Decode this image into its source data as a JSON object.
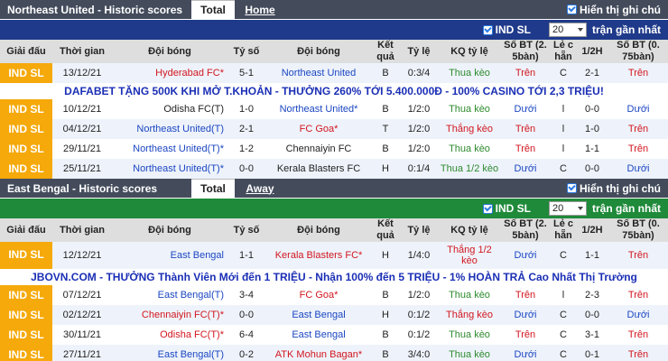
{
  "section1": {
    "title": "Northeast United - Historic scores",
    "tab_total": "Total",
    "tab_other": "Home",
    "show_notes": "Hiển thị ghi chú",
    "league_filter": "IND SL",
    "count": "20",
    "recent_label": "trận gần nhất",
    "banner": "DAFABET TẶNG 500K KHI MỞ T.KHOẢN - THƯỞNG 260% TỚI 5.400.000Đ - 100% CASINO TỚI 2,3 TRIỆU!"
  },
  "section2": {
    "title": "East Bengal - Historic scores",
    "tab_total": "Total",
    "tab_other": "Away",
    "show_notes": "Hiển thị ghi chú",
    "league_filter": "IND SL",
    "count": "20",
    "recent_label": "trận gần nhất",
    "banner": "JBOVN.COM - THƯỞNG Thành Viên Mới đến 1 TRIỆU - Nhận 100% đến 5 TRIỆU - 1% HOÀN TRẢ Cao Nhất Thị Trường"
  },
  "headers": {
    "league": "Giải đấu",
    "time": "Thời gian",
    "home": "Đội bóng",
    "score": "Tỷ số",
    "away": "Đội bóng",
    "result": "Kết quả",
    "odds": "Tỷ lệ",
    "odds_result": "KQ tỷ lệ",
    "goals25": "Số BT (2. 5bàn)",
    "oddeven": "Lẻ c hẵn",
    "half": "1/2H",
    "goals075": "Số BT (0. 75bàn)"
  },
  "colors": {
    "league_bg": "#f5a90a",
    "team_blue": "#1b46c2",
    "team_red": "#d2161f",
    "win_green": "#2e8b2e",
    "filterbar_blue": "#1f3a8a",
    "filterbar_green": "#1f8a3a"
  },
  "rows1": [
    {
      "league": "IND SL",
      "date": "13/12/21",
      "home": "Hyderabad FC*",
      "score": "5-1",
      "away": "Northeast United",
      "res": "B",
      "odds": "0:3/4",
      "oddsres": "Thua kèo",
      "g25": "Trên",
      "oe": "C",
      "half": "2-1",
      "g075": "Trên"
    },
    {
      "league": "IND SL",
      "date": "10/12/21",
      "home": "Odisha FC(T)",
      "score": "1-0",
      "away": "Northeast United*",
      "res": "B",
      "odds": "1/2:0",
      "oddsres": "Thua kèo",
      "g25": "Dưới",
      "oe": "l",
      "half": "0-0",
      "g075": "Dưới"
    },
    {
      "league": "IND SL",
      "date": "04/12/21",
      "home": "Northeast United(T)",
      "score": "2-1",
      "away": "FC Goa*",
      "res": "T",
      "odds": "1/2:0",
      "oddsres": "Thắng kèo",
      "g25": "Trên",
      "oe": "l",
      "half": "1-0",
      "g075": "Trên"
    },
    {
      "league": "IND SL",
      "date": "29/11/21",
      "home": "Northeast United(T)*",
      "score": "1-2",
      "away": "Chennaiyin FC",
      "res": "B",
      "odds": "1/2:0",
      "oddsres": "Thua kèo",
      "g25": "Trên",
      "oe": "l",
      "half": "1-1",
      "g075": "Trên"
    },
    {
      "league": "IND SL",
      "date": "25/11/21",
      "home": "Northeast United(T)*",
      "score": "0-0",
      "away": "Kerala Blasters FC",
      "res": "H",
      "odds": "0:1/4",
      "oddsres": "Thua 1/2 kèo",
      "g25": "Dưới",
      "oe": "C",
      "half": "0-0",
      "g075": "Dưới"
    }
  ],
  "rows2": [
    {
      "league": "IND SL",
      "date": "12/12/21",
      "home": "East Bengal",
      "score": "1-1",
      "away": "Kerala Blasters FC*",
      "res": "H",
      "odds": "1/4:0",
      "oddsres": "Thắng 1/2 kèo",
      "g25": "Dưới",
      "oe": "C",
      "half": "1-1",
      "g075": "Trên"
    },
    {
      "league": "IND SL",
      "date": "07/12/21",
      "home": "East Bengal(T)",
      "score": "3-4",
      "away": "FC Goa*",
      "res": "B",
      "odds": "1/2:0",
      "oddsres": "Thua kèo",
      "g25": "Trên",
      "oe": "l",
      "half": "2-3",
      "g075": "Trên"
    },
    {
      "league": "IND SL",
      "date": "02/12/21",
      "home": "Chennaiyin FC(T)*",
      "score": "0-0",
      "away": "East Bengal",
      "res": "H",
      "odds": "0:1/2",
      "oddsres": "Thắng kèo",
      "g25": "Dưới",
      "oe": "C",
      "half": "0-0",
      "g075": "Dưới"
    },
    {
      "league": "IND SL",
      "date": "30/11/21",
      "home": "Odisha FC(T)*",
      "score": "6-4",
      "away": "East Bengal",
      "res": "B",
      "odds": "0:1/2",
      "oddsres": "Thua kèo",
      "g25": "Trên",
      "oe": "C",
      "half": "3-1",
      "g075": "Trên"
    },
    {
      "league": "IND SL",
      "date": "27/11/21",
      "home": "East Bengal(T)",
      "score": "0-2",
      "away": "ATK Mohun Bagan*",
      "res": "B",
      "odds": "3/4:0",
      "oddsres": "Thua kèo",
      "g25": "Dưới",
      "oe": "C",
      "half": "0-1",
      "g075": "Trên"
    }
  ]
}
